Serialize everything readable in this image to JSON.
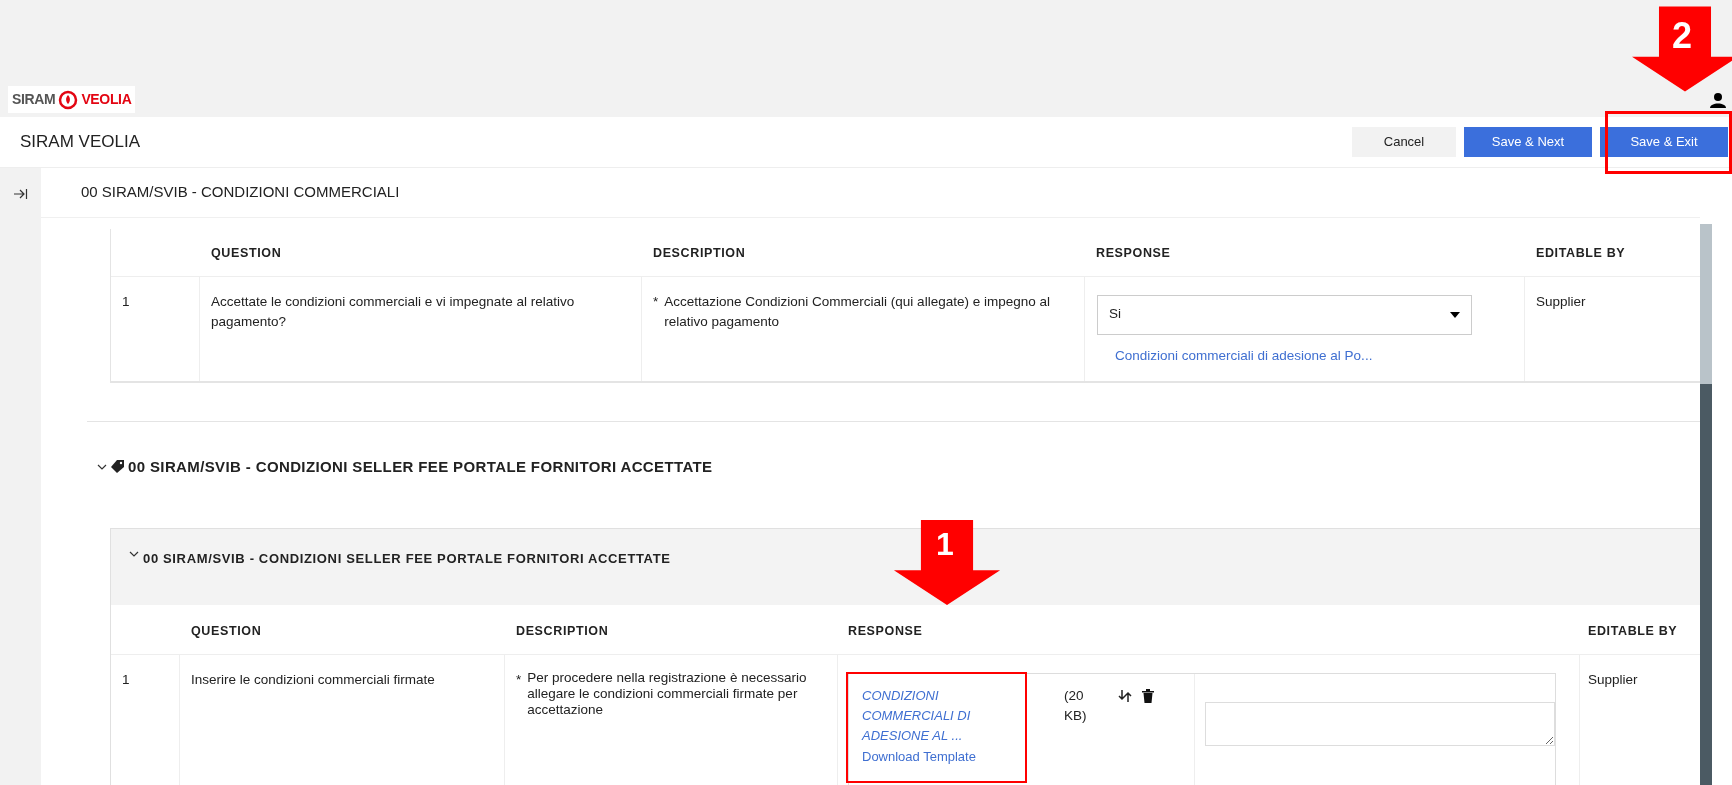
{
  "logo": {
    "left": "SIRAM",
    "right": "VEOLIA"
  },
  "header": {
    "title": "SIRAM VEOLIA",
    "buttons": [
      {
        "label": "Cancel",
        "kind": "secondary"
      },
      {
        "label": "Save & Next",
        "kind": "primary"
      },
      {
        "label": "Save & Exit",
        "kind": "primary"
      }
    ]
  },
  "section_title": "00 SIRAM/SVIB - CONDIZIONI COMMERCIALI",
  "table1": {
    "columns": [
      "QUESTION",
      "DESCRIPTION",
      "RESPONSE",
      "EDITABLE BY"
    ],
    "rows": [
      {
        "number": "1",
        "question": "Accettate le condizioni commerciali e vi impegnate al relativo pagamento?",
        "required_mark": "*",
        "description": "Accettazione Condizioni Commerciali (qui allegate) e impegno al relativo pagamento",
        "response": {
          "value": "Si",
          "attachment": "Condizioni commerciali di adesione al Po..."
        },
        "editable_by": "Supplier"
      }
    ]
  },
  "section2": {
    "title": "00 SIRAM/SVIB - CONDIZIONI SELLER FEE PORTALE FORNITORI ACCETTATE",
    "expanded": true,
    "card": {
      "title": "00 SIRAM/SVIB - CONDIZIONI SELLER FEE PORTALE FORNITORI ACCETTATE",
      "expanded": true,
      "columns": [
        "QUESTION",
        "DESCRIPTION",
        "RESPONSE",
        "EDITABLE BY"
      ],
      "rows": [
        {
          "number": "1",
          "question": "Inserire le condizioni commerciali firmate",
          "required_mark": "*",
          "description": "Per procedere nella registrazione è necessario allegare le condizioni commerciali firmate per accettazione",
          "response": {
            "file_name": "CONDIZIONI COMMERCIALI DI ADESIONE AL ...",
            "file_size": "(20 KB)",
            "template_link": "Download Template"
          },
          "editable_by": "Supplier"
        }
      ]
    }
  },
  "annotations": [
    {
      "number": "1"
    },
    {
      "number": "2"
    }
  ]
}
